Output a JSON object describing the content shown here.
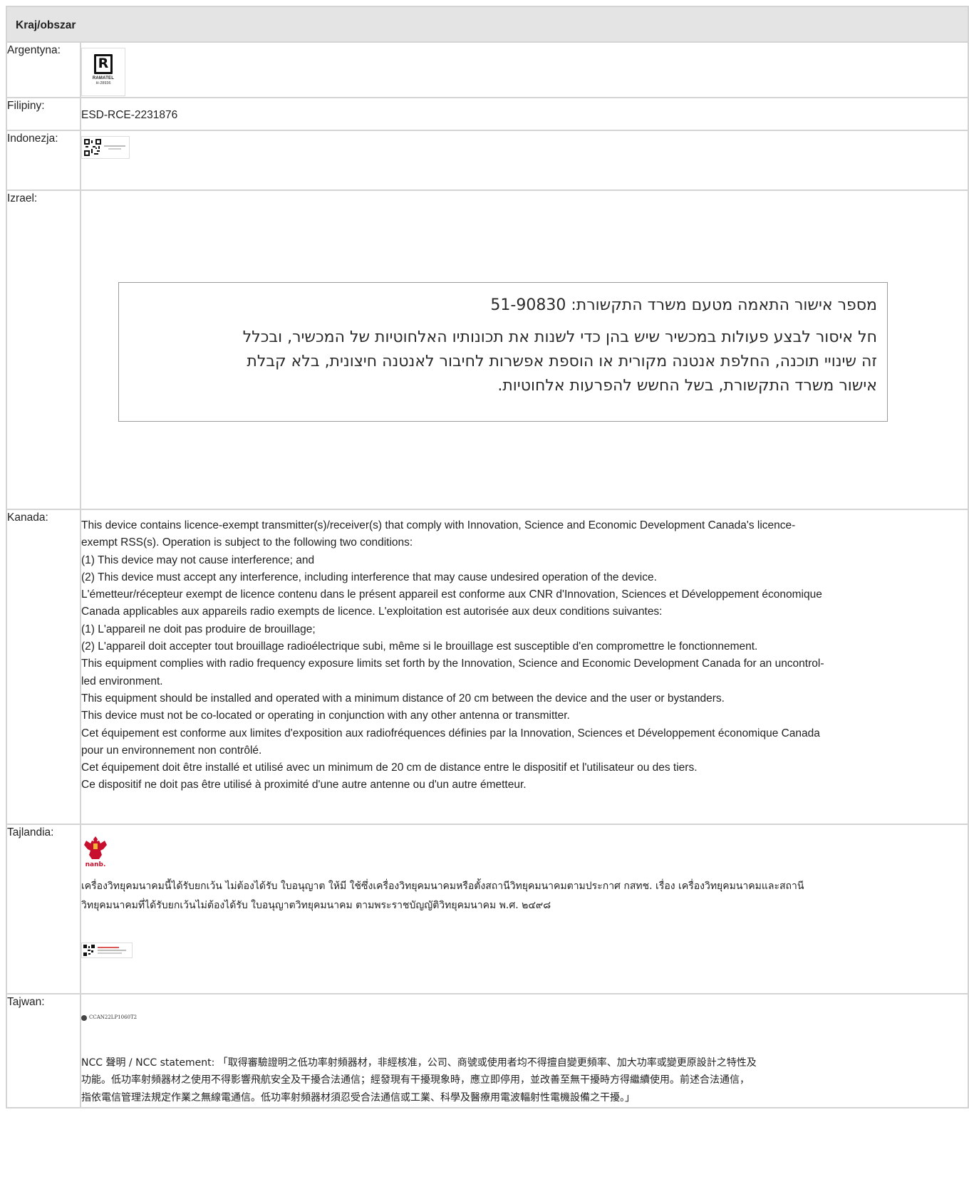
{
  "table": {
    "header": "Kraj/obszar",
    "rows": {
      "argentina": {
        "label": "Argentyna:",
        "logo_text": "RAMATEL",
        "logo_number": "H-28936"
      },
      "philippines": {
        "label": "Filipiny:",
        "value": "ESD-RCE-2231876"
      },
      "indonesia": {
        "label": "Indonezja:"
      },
      "israel": {
        "label": "Izrael:",
        "line1": "מספר אישור התאמה מטעם משרד התקשורת: 51-90830",
        "paragraph": [
          "חל איסור לבצע פעולות במכשיר שיש בהן כדי לשנות את תכונותיו האלחוטיות של המכשיר, ובכלל",
          "זה שינויי תוכנה, החלפת אנטנה מקורית או הוספת אפשרות לחיבור לאנטנה חיצונית, בלא קבלת",
          "אישור משרד התקשורת, בשל החשש להפרעות אלחוטיות."
        ]
      },
      "canada": {
        "label": "Kanada:",
        "lines": [
          "This device contains licence-exempt transmitter(s)/receiver(s) that comply with Innovation, Science and Economic Development Canada's licence-",
          "exempt RSS(s). Operation is subject to the following two conditions:",
          "(1) This device may not cause interference; and",
          "(2) This device must accept any interference, including interference that may cause undesired operation of the device.",
          "L'émetteur/récepteur exempt de licence contenu dans le présent appareil est conforme aux CNR d'Innovation, Sciences et Développement économique",
          "Canada applicables aux appareils radio exempts de licence. L'exploitation est autorisée aux deux conditions suivantes:",
          "(1) L'appareil ne doit pas produire de brouillage;",
          "(2) L'appareil doit accepter tout brouillage radioélectrique subi, même si le brouillage est susceptible d'en compromettre le fonctionnement.",
          "This equipment complies with radio frequency exposure limits set forth by the Innovation, Science and Economic Development Canada for an uncontrol-",
          "led environment.",
          "This equipment should be installed and operated with a minimum distance of 20 cm between the device and the user or bystanders.",
          "This device must not be co-located or operating in conjunction with any other antenna or transmitter.",
          "Cet équipement est conforme aux limites d'exposition aux radiofréquences définies par la Innovation, Sciences et Développement économique Canada",
          "pour un environnement non contrôlé.",
          "Cet équipement doit être installé et utilisé avec un minimum de 20 cm de distance entre le dispositif et l'utilisateur ou des tiers.",
          "Ce dispositif ne doit pas être utilisé à proximité d'une autre antenne ou d'un autre émetteur."
        ]
      },
      "thailand": {
        "label": "Tajlandia:",
        "logo_text": "nanb.",
        "lines": [
          "เครื่องวิทยุคมนาคมนี้ได้รับยกเว้น ไม่ต้องได้รับ ใบอนุญาต ให้มี ใช้ซึ่งเครื่องวิทยุคมนาคมหรือตั้งสถานีวิทยุคมนาคมตามประกาศ กสทช. เรื่อง เครื่องวิทยุคมนาคมและสถานี",
          "วิทยุคมนาคมที่ได้รับยกเว้นไม่ต้องได้รับ ใบอนุญาตวิทยุคมนาคม ตามพระราชบัญญัติวิทยุคมนาคม พ.ศ. ๒๔๙๘"
        ]
      },
      "taiwan": {
        "label": "Tajwan:",
        "mark_code": "CCAN22LP1060T2",
        "lines": [
          "NCC 聲明 / NCC statement: 「取得審驗證明之低功率射頻器材，非經核准，公司、商號或使用者均不得擅自變更頻率、加大功率或變更原設計之特性及",
          "功能。低功率射頻器材之使用不得影響飛航安全及干擾合法通信；經發現有干擾現象時，應立即停用，並改善至無干擾時方得繼續使用。前述合法通信，",
          "指依電信管理法規定作業之無線電通信。低功率射頻器材須忍受合法通信或工業、科學及醫療用電波輻射性電機設備之干擾。」"
        ]
      }
    }
  }
}
